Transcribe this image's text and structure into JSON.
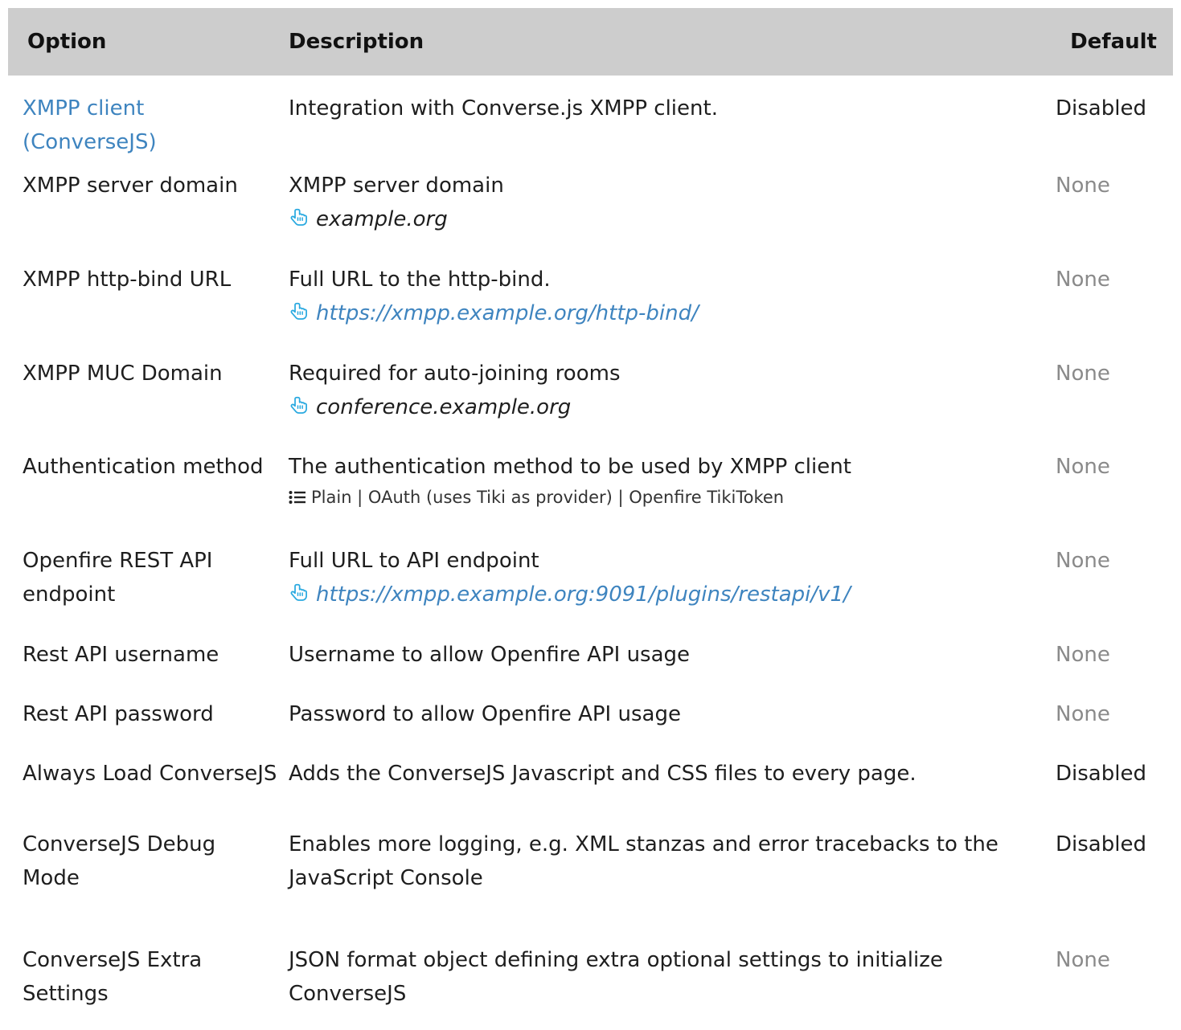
{
  "headers": {
    "option": "Option",
    "description": "Description",
    "default": "Default"
  },
  "rows": [
    {
      "option": "XMPP client (ConverseJS)",
      "description": "Integration with Converse.js XMPP client.",
      "default": "Disabled"
    },
    {
      "option": "XMPP server domain",
      "description": "XMPP server domain",
      "example": "example.org",
      "default": "None"
    },
    {
      "option": "XMPP http-bind URL",
      "description": "Full URL to the http-bind.",
      "example": "https://xmpp.example.org/http-bind/",
      "default": "None"
    },
    {
      "option": "XMPP MUC Domain",
      "description": "Required for auto-joining rooms",
      "example": "conference.example.org",
      "default": "None"
    },
    {
      "option": "Authentication method",
      "description": "The authentication method to be used by XMPP client",
      "options": "Plain | OAuth (uses Tiki as provider) | Openfire TikiToken",
      "default": "None"
    },
    {
      "option": "Openfire REST API endpoint",
      "description": "Full URL to API endpoint",
      "example": "https://xmpp.example.org:9091/plugins/restapi/v1/",
      "default": "None"
    },
    {
      "option": "Rest API username",
      "description": "Username to allow Openfire API usage",
      "default": "None"
    },
    {
      "option": "Rest API password",
      "description": "Password to allow Openfire API usage",
      "default": "None"
    },
    {
      "option": "Always Load ConverseJS",
      "description": "Adds the ConverseJS Javascript and CSS files to every page.",
      "default": "Disabled"
    },
    {
      "option": "ConverseJS Debug Mode",
      "description": "Enables more logging, e.g. XML stanzas and error tracebacks to the JavaScript Console",
      "default": "Disabled"
    },
    {
      "option": "ConverseJS Extra Settings",
      "description": "JSON format object defining extra optional settings to initialize ConverseJS",
      "default": "None"
    }
  ],
  "icons": {
    "example": "pointing-hand-icon",
    "options": "list-icon"
  },
  "colors": {
    "header_bg": "#cdcdcd",
    "link": "#3e84bf",
    "muted": "#8a8a8a",
    "icon": "#29a9e0"
  }
}
